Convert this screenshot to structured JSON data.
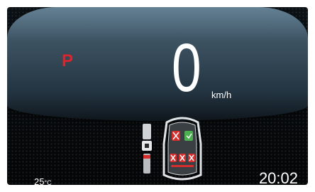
{
  "cluster": {
    "gear": "P",
    "speed": "0",
    "speed_unit": "km/h",
    "temperature": "25",
    "temperature_unit": "°C",
    "time": "20:02"
  },
  "indicators": {
    "seatbelt": "seatbelt-icon",
    "seat_status": "seat-occupancy-icon"
  },
  "colors": {
    "gear_color": "#e0232a",
    "warning_red": "#d62d2d",
    "ok_green": "#4caf50",
    "text": "#ffffff"
  }
}
